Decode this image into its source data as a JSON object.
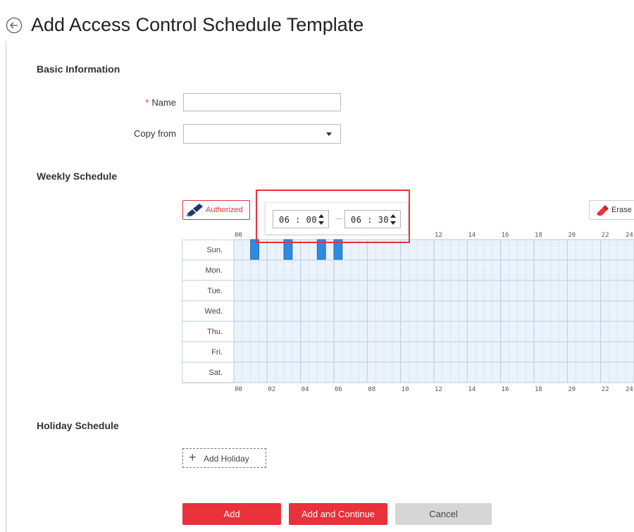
{
  "header": {
    "title": "Add Access Control Schedule Template"
  },
  "basic_info": {
    "section_title": "Basic Information",
    "name_required_mark": "*",
    "name_label": "Name",
    "name_value": "",
    "copy_from_label": "Copy from",
    "copy_from_value": ""
  },
  "weekly": {
    "section_title": "Weekly Schedule",
    "authorized_label": "Authorized",
    "erase_label": "Erase",
    "time_picker": {
      "start": "06 : 00",
      "end": "06 : 30"
    },
    "days": [
      "Sun.",
      "Mon.",
      "Tue.",
      "Wed.",
      "Thu.",
      "Fri.",
      "Sat."
    ],
    "hour_ticks_top": [
      "00",
      "12",
      "14",
      "16",
      "18",
      "20",
      "22",
      "24"
    ],
    "hour_ticks_bottom": [
      "00",
      "02",
      "04",
      "06",
      "08",
      "10",
      "12",
      "14",
      "16",
      "18",
      "20",
      "22",
      "24"
    ],
    "authorized_blocks": [
      {
        "day": "Sun.",
        "start_hour": 1.0,
        "end_hour": 1.5
      },
      {
        "day": "Sun.",
        "start_hour": 3.0,
        "end_hour": 3.5
      },
      {
        "day": "Sun.",
        "start_hour": 5.0,
        "end_hour": 5.5
      },
      {
        "day": "Sun.",
        "start_hour": 6.0,
        "end_hour": 6.5
      }
    ],
    "colors": {
      "grid_fill": "#eaf2fb",
      "block": "#2f8ae0",
      "accent": "#e8313a"
    }
  },
  "holiday": {
    "section_title": "Holiday Schedule",
    "add_holiday_label": "Add Holiday"
  },
  "footer": {
    "add_label": "Add",
    "add_continue_label": "Add and Continue",
    "cancel_label": "Cancel"
  }
}
